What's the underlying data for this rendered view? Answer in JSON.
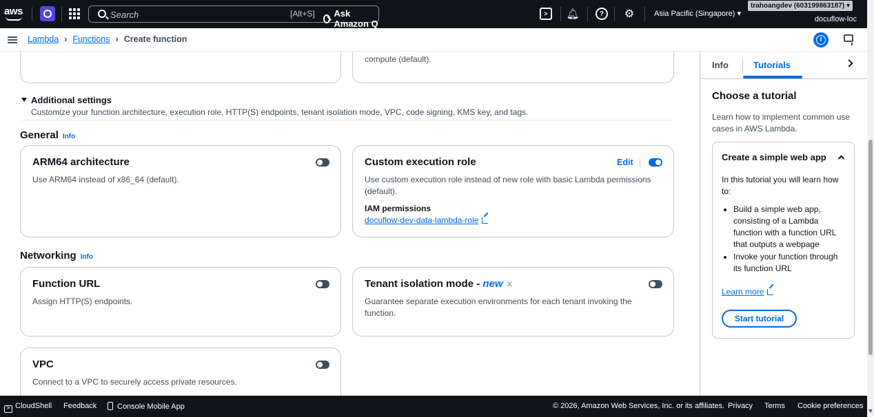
{
  "topnav": {
    "logo": "aws",
    "search_placeholder": "Search",
    "search_shortcut": "[Alt+S]",
    "ask_q": "Ask Amazon Q",
    "region": "Asia Pacific (Singapore)",
    "account_badge": "trahoangdev (603199863187)",
    "account_name": "docuflow-loc",
    "icons": [
      "services-icon",
      "apps-grid-icon",
      "cloudshell-icon",
      "notifications-icon",
      "help-icon",
      "settings-icon"
    ]
  },
  "breadcrumb": {
    "items": [
      "Lambda",
      "Functions",
      "Create function"
    ]
  },
  "main": {
    "partial_card_text": "compute (default).",
    "additional_settings": {
      "title": "Additional settings",
      "description": "Customize your function architecture, execution role, HTTP(S) endpoints, tenant isolation mode, VPC, code signing, KMS key, and tags."
    },
    "general": {
      "heading": "General",
      "info": "Info",
      "arm": {
        "title": "ARM64 architecture",
        "description": "Use ARM64 instead of x86_64 (default).",
        "enabled": false
      },
      "exec_role": {
        "title": "Custom execution role",
        "edit": "Edit",
        "description": "Use custom execution role instead of new role with basic Lambda permissions (default).",
        "iam_label": "IAM permissions",
        "iam_role": "docuflow-dev-data-lambda-role",
        "enabled": true
      }
    },
    "networking": {
      "heading": "Networking",
      "info": "Info",
      "function_url": {
        "title": "Function URL",
        "description": "Assign HTTP(S) endpoints.",
        "enabled": false
      },
      "tenant": {
        "title": "Tenant isolation mode -",
        "new_tag": "new",
        "description": "Guarantee separate execution environments for each tenant invoking the function.",
        "enabled": false
      },
      "vpc": {
        "title": "VPC",
        "description": "Connect to a VPC to securely access private resources.",
        "enabled": false
      }
    }
  },
  "right_panel": {
    "tabs": [
      "Info",
      "Tutorials"
    ],
    "active_tab": "Tutorials",
    "title": "Choose a tutorial",
    "description": "Learn how to implement common use cases in AWS Lambda.",
    "tutorial": {
      "title": "Create a simple web app",
      "intro": "In this tutorial you will learn how to:",
      "items": [
        "Build a simple web app, consisting of a Lambda function with a function URL that outputs a webpage",
        "Invoke your function through its function URL"
      ],
      "learn_more": "Learn more",
      "start": "Start tutorial"
    }
  },
  "footer": {
    "cloudshell": "CloudShell",
    "feedback": "Feedback",
    "mobile_app": "Console Mobile App",
    "copyright": "© 2026, Amazon Web Services, Inc. or its affiliates.",
    "privacy": "Privacy",
    "terms": "Terms",
    "cookies": "Cookie preferences"
  },
  "colors": {
    "nav_bg": "#0f141a",
    "link": "#006ce0",
    "toggle_off": "#414d5c",
    "toggle_on": "#006ce0",
    "border": "#c6c6cd"
  }
}
